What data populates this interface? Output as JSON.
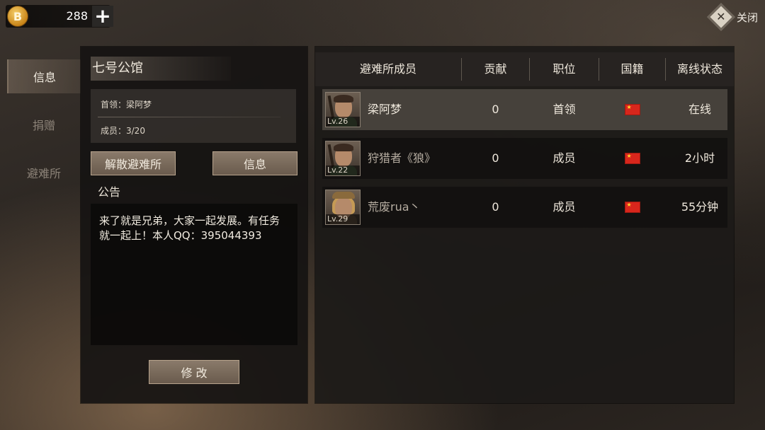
{
  "currency": {
    "icon": "coin-icon",
    "value": "288",
    "add_label": "+"
  },
  "close": {
    "label": "关闭",
    "icon_glyph": "✕"
  },
  "tabs": [
    {
      "label": "信息",
      "active": true
    },
    {
      "label": "捐赠",
      "active": false
    },
    {
      "label": "避难所",
      "active": false
    }
  ],
  "shelter": {
    "name": "七号公馆",
    "leader_line": "首领：梁阿梦",
    "members_line": "成员：3/20",
    "disband_label": "解散避难所",
    "info_label": "信息",
    "notice_title": "公告",
    "notice_text": "来了就是兄弟，大家一起发展。有任务就一起上！本人QQ：395044393",
    "edit_label": "修 改"
  },
  "table": {
    "headers": [
      "避难所成员",
      "贡献",
      "职位",
      "国籍",
      "离线状态"
    ],
    "rows": [
      {
        "level": "Lv.26",
        "name": "梁阿梦",
        "contribution": "0",
        "role": "首领",
        "status": "在线",
        "avatar": "male-soldier",
        "highlight": true
      },
      {
        "level": "Lv.22",
        "name": "狩猎者《狼》",
        "contribution": "0",
        "role": "成员",
        "status": "2小时",
        "avatar": "male-soldier",
        "highlight": false
      },
      {
        "level": "Lv.29",
        "name": "荒废rua丶",
        "contribution": "0",
        "role": "成员",
        "status": "55分钟",
        "avatar": "female-cap",
        "highlight": false
      }
    ]
  },
  "colors": {
    "accent_button": "#7a6a5b",
    "flag_red": "#d8261c",
    "flag_star": "#ffd92e"
  }
}
